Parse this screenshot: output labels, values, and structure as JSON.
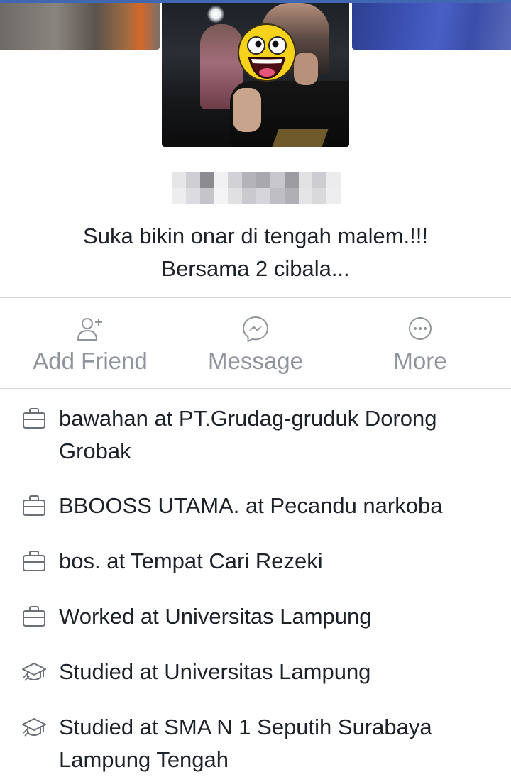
{
  "profile": {
    "bio_line1": "Suka bikin onar di tengah malem.!!!",
    "bio_line2": "Bersama 2 cibala..."
  },
  "actions": [
    {
      "label": "Add Friend",
      "icon": "add-friend-icon"
    },
    {
      "label": "Message",
      "icon": "messenger-icon"
    },
    {
      "label": "More",
      "icon": "more-icon"
    }
  ],
  "intro": [
    {
      "icon": "briefcase-icon",
      "text": "bawahan at PT.Grudag-gruduk Dorong Grobak"
    },
    {
      "icon": "briefcase-icon",
      "text": "BBOOSS UTAMA. at Pecandu narkoba"
    },
    {
      "icon": "briefcase-icon",
      "text": "bos. at Tempat Cari Rezeki"
    },
    {
      "icon": "briefcase-icon",
      "text": "Worked at Universitas Lampung"
    },
    {
      "icon": "graduation-cap-icon",
      "text": "Studied at Universitas Lampung"
    },
    {
      "icon": "graduation-cap-icon",
      "text": "Studied at SMA N 1 Seputih Surabaya Lampung Tengah"
    }
  ],
  "colors": {
    "brand": "#4267b2",
    "text": "#1d2129",
    "muted": "#90949c",
    "divider": "#d1d3d6"
  }
}
